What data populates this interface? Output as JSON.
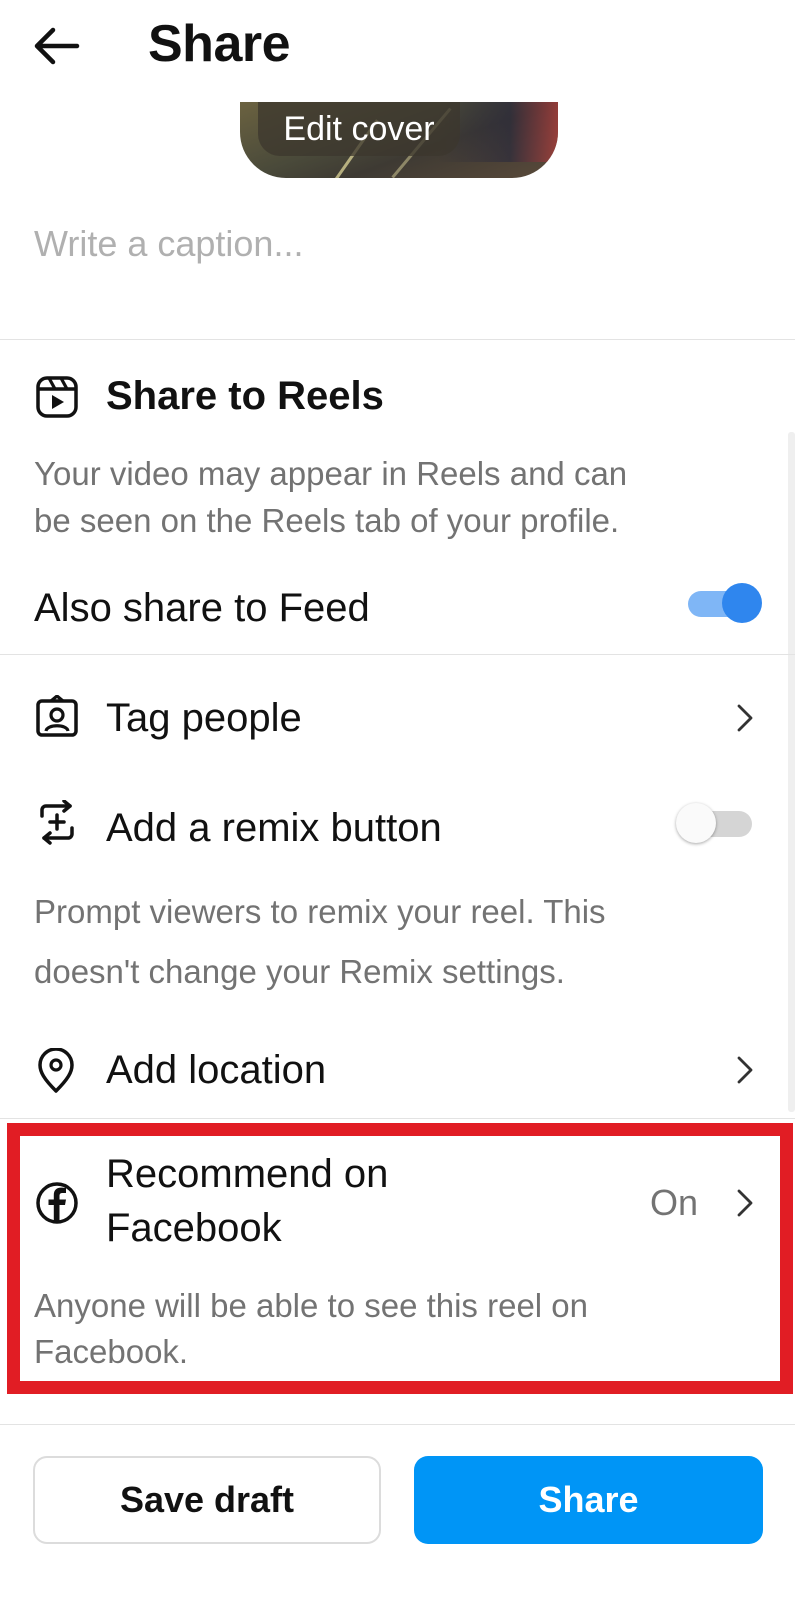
{
  "header": {
    "title": "Share"
  },
  "cover": {
    "edit_label": "Edit cover"
  },
  "caption": {
    "placeholder": "Write a caption..."
  },
  "reels": {
    "title": "Share to Reels",
    "description_line1": "Your video may appear in Reels and can",
    "description_line2": "be seen on the Reels tab of your profile.",
    "feed_label": "Also share to Feed",
    "feed_toggle": "on"
  },
  "tag_people": {
    "label": "Tag people"
  },
  "remix": {
    "label": "Add a remix button",
    "toggle": "off",
    "description_line1": "Prompt viewers to remix your reel. This",
    "description_line2": "doesn't change your Remix settings."
  },
  "location": {
    "label": "Add location"
  },
  "facebook": {
    "label_line1": "Recommend on",
    "label_line2": "Facebook",
    "value": "On",
    "description_line1": "Anyone will be able to see this reel on",
    "description_line2": "Facebook."
  },
  "footer": {
    "save_draft_label": "Save draft",
    "share_label": "Share"
  },
  "colors": {
    "accent": "#0095f6",
    "toggle_on": "#2f86ee",
    "highlight": "#e11d24"
  }
}
